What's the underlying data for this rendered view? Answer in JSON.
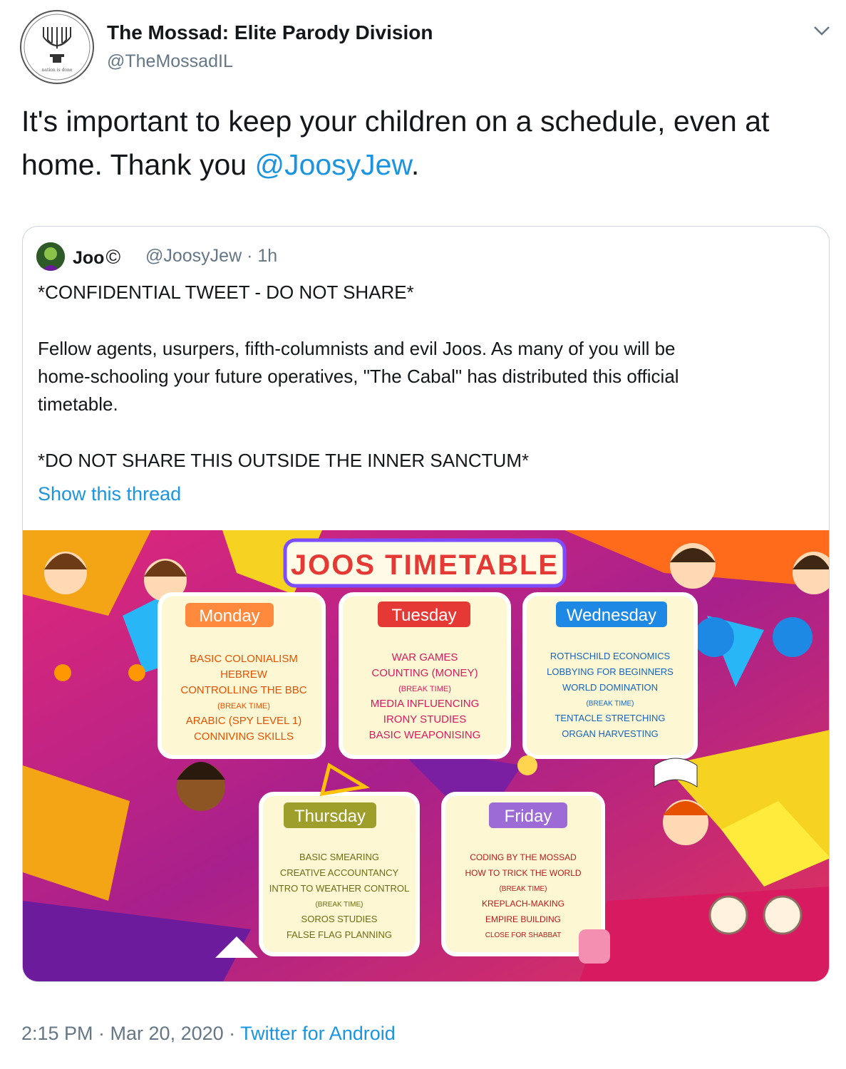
{
  "tweet": {
    "author_name": "The Mossad: Elite Parody Division",
    "author_handle": "@TheMossadIL",
    "text_before": "It's important to keep your children on a schedule, even at home. Thank you ",
    "mention": "@JoosyJew",
    "text_after": ".",
    "timestamp": "2:15 PM · Mar 20, 2020 · ",
    "source": "Twitter for Android"
  },
  "quote": {
    "name": "Joo",
    "name_symbol": "©",
    "handle_time": "@JoosyJew · 1h",
    "line1": "*CONFIDENTIAL TWEET - DO NOT SHARE*",
    "para1_line1": "Fellow agents, usurpers, fifth-columnists and evil Joos. As many of you will be",
    "para1_line2": "home-schooling your future operatives, \"The Cabal\" has distributed this official",
    "para1_line3": "timetable.",
    "line_last": "*DO NOT SHARE THIS OUTSIDE THE INNER SANCTUM*",
    "show_thread": "Show this thread"
  },
  "timetable": {
    "title": "JOOS TIMETABLE",
    "days": [
      {
        "name": "Monday",
        "items": [
          "BASIC COLONIALISM",
          "HEBREW",
          "CONTROLLING THE BBC",
          "(BREAK TIME)",
          "ARABIC (SPY LEVEL 1)",
          "CONNIVING SKILLS"
        ]
      },
      {
        "name": "Tuesday",
        "items": [
          "WAR GAMES",
          "COUNTING (MONEY)",
          "(BREAK TIME)",
          "MEDIA INFLUENCING",
          "IRONY STUDIES",
          "BASIC WEAPONISING"
        ]
      },
      {
        "name": "Wednesday",
        "items": [
          "ROTHSCHILD ECONOMICS",
          "LOBBYING FOR BEGINNERS",
          "WORLD DOMINATION",
          "(BREAK TIME)",
          "TENTACLE STRETCHING",
          "ORGAN HARVESTING"
        ]
      },
      {
        "name": "Thursday",
        "items": [
          "BASIC SMEARING",
          "CREATIVE ACCOUNTANCY",
          "INTRO TO WEATHER CONTROL",
          "(BREAK TIME)",
          "SOROS STUDIES",
          "FALSE FLAG PLANNING"
        ]
      },
      {
        "name": "Friday",
        "items": [
          "CODING BY THE MOSSAD",
          "HOW TO TRICK THE WORLD",
          "(BREAK TIME)",
          "KREPLACH-MAKING",
          "EMPIRE BUILDING",
          "CLOSE FOR SHABBAT"
        ]
      }
    ]
  }
}
